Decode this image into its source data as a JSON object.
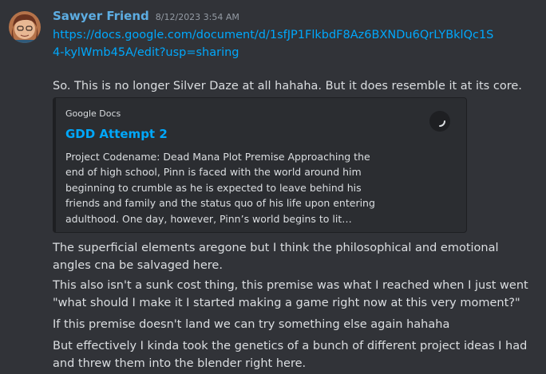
{
  "message": {
    "author": "Sawyer Friend",
    "timestamp": "8/12/2023 3:54 AM",
    "link": "https://docs.google.com/document/d/1sfJP1FlkbdF8Az6BXNDu6QrLYBklQc1S4-kylWmb45A/edit?usp=sharing",
    "text1": "So. This is no longer Silver Daze at all hahaha. But it does resemble it at its core.",
    "embed": {
      "provider": "Google Docs",
      "title": "GDD Attempt 2",
      "description": "Project Codename: Dead Mana Plot Premise Approaching the end of high school, Pinn is faced with the world around him beginning to crumble as he is expected to leave behind his friends and family and the status quo of his life upon entering adulthood. One day, however, Pinn’s world begins to lit…",
      "thumbnail_icon": "loading-spinner-icon"
    },
    "followups": [
      "The superficial elements aregone but I think the philosophical and emotional angles cna be salvaged here.",
      "This also isn't a sunk cost thing, this premise was what I reached when I just went \"what should I make it I started making a game right now at this very moment?\"",
      "If this premise doesn't land we can try something else again hahaha",
      "But effectively I kinda took the genetics of a bunch of different project ideas I had and threw them into the blender right here."
    ]
  },
  "colors": {
    "background": "#313338",
    "username": "#5dade2",
    "link": "#00a8fc",
    "embed_bg": "#2b2d31"
  }
}
